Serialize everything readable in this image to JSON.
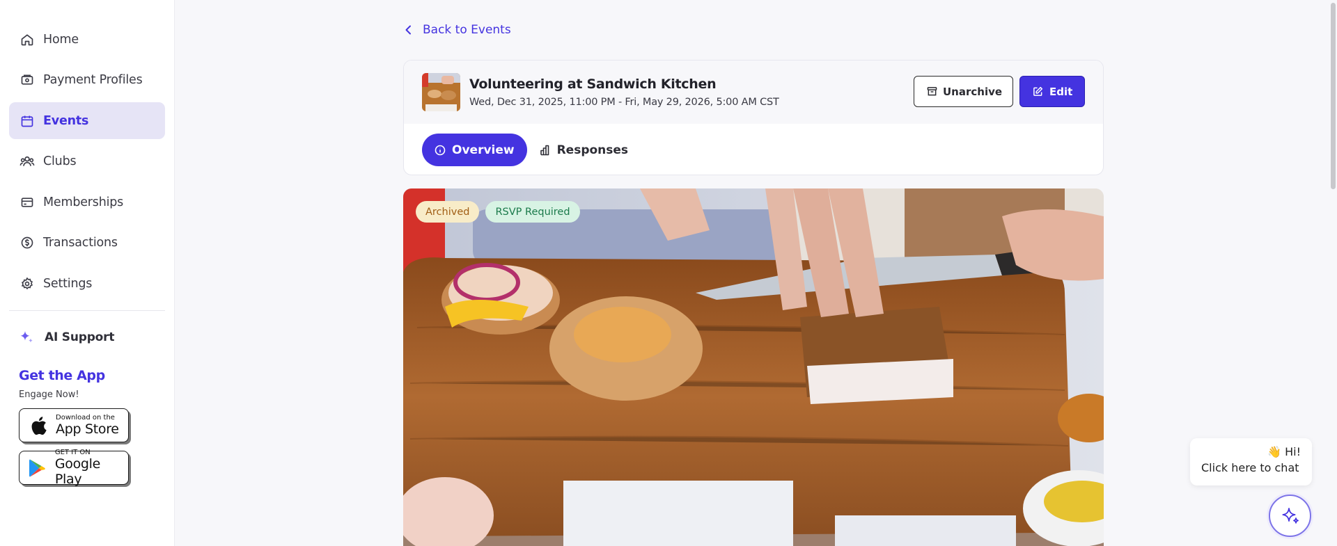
{
  "sidebar": {
    "items": [
      {
        "label": "Home",
        "icon": "home-icon",
        "active": false
      },
      {
        "label": "Payment Profiles",
        "icon": "wallet-icon",
        "active": false
      },
      {
        "label": "Events",
        "icon": "calendar-icon",
        "active": true
      },
      {
        "label": "Clubs",
        "icon": "users-icon",
        "active": false
      },
      {
        "label": "Memberships",
        "icon": "card-icon",
        "active": false
      },
      {
        "label": "Transactions",
        "icon": "dollar-circle-icon",
        "active": false
      },
      {
        "label": "Settings",
        "icon": "gear-icon",
        "active": false
      }
    ],
    "ai_support": "AI Support",
    "get_app": {
      "title": "Get the App",
      "subtitle": "Engage Now!",
      "app_store": {
        "small": "Download on the",
        "big": "App Store"
      },
      "google_play": {
        "small": "GET IT ON",
        "big": "Google Play"
      }
    }
  },
  "main": {
    "back_label": "Back to Events",
    "event": {
      "title": "Volunteering at Sandwich Kitchen",
      "date": "Wed, Dec 31, 2025, 11:00 PM - Fri, May 29, 2026, 5:00 AM CST",
      "unarchive_label": "Unarchive",
      "edit_label": "Edit"
    },
    "tabs": [
      {
        "label": "Overview",
        "active": true
      },
      {
        "label": "Responses",
        "active": false
      }
    ],
    "badges": [
      "Archived",
      "RSVP Required"
    ]
  },
  "chat": {
    "hi": "👋 Hi!",
    "prompt": "Click here to chat"
  },
  "colors": {
    "accent": "#4433e0",
    "active_nav_bg": "#e6e4f6",
    "archived_bg": "#f8ecc8",
    "rsvp_bg": "#d8f3e4"
  }
}
